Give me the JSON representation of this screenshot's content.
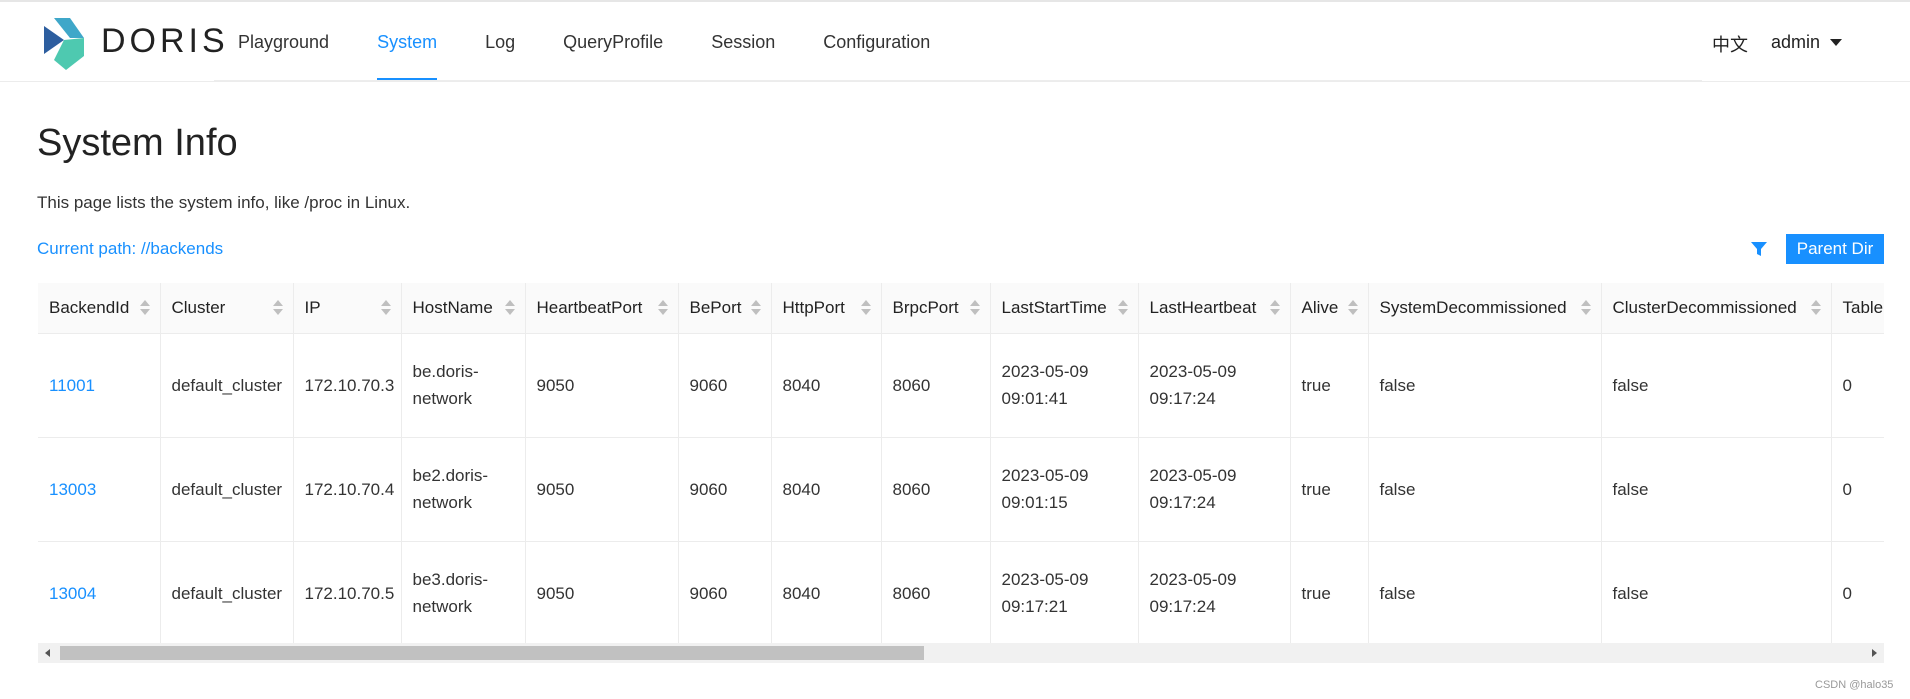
{
  "header": {
    "brand": "DORIS",
    "nav": [
      {
        "label": "Playground",
        "active": false
      },
      {
        "label": "System",
        "active": true
      },
      {
        "label": "Log",
        "active": false
      },
      {
        "label": "QueryProfile",
        "active": false
      },
      {
        "label": "Session",
        "active": false
      },
      {
        "label": "Configuration",
        "active": false
      }
    ],
    "language": "中文",
    "user": "admin"
  },
  "page": {
    "title": "System Info",
    "description": "This page lists the system info, like /proc in Linux.",
    "current_path": "Current path: //backends",
    "parent_dir_label": "Parent Dir"
  },
  "table": {
    "columns": [
      "BackendId",
      "Cluster",
      "IP",
      "HostName",
      "HeartbeatPort",
      "BePort",
      "HttpPort",
      "BrpcPort",
      "LastStartTime",
      "LastHeartbeat",
      "Alive",
      "SystemDecommissioned",
      "ClusterDecommissioned",
      "Table"
    ],
    "rows": [
      {
        "backend_id": "11001",
        "cluster": "default_cluster",
        "ip": "172.10.70.3",
        "hostname_1": "be.doris-",
        "hostname_2": "network",
        "heartbeat_port": "9050",
        "be_port": "9060",
        "http_port": "8040",
        "brpc_port": "8060",
        "last_start_1": "2023-05-09",
        "last_start_2": "09:01:41",
        "last_hb_1": "2023-05-09",
        "last_hb_2": "09:17:24",
        "alive": "true",
        "sys_decom": "false",
        "cluster_decom": "false",
        "table_num": "0"
      },
      {
        "backend_id": "13003",
        "cluster": "default_cluster",
        "ip": "172.10.70.4",
        "hostname_1": "be2.doris-",
        "hostname_2": "network",
        "heartbeat_port": "9050",
        "be_port": "9060",
        "http_port": "8040",
        "brpc_port": "8060",
        "last_start_1": "2023-05-09",
        "last_start_2": "09:01:15",
        "last_hb_1": "2023-05-09",
        "last_hb_2": "09:17:24",
        "alive": "true",
        "sys_decom": "false",
        "cluster_decom": "false",
        "table_num": "0"
      },
      {
        "backend_id": "13004",
        "cluster": "default_cluster",
        "ip": "172.10.70.5",
        "hostname_1": "be3.doris-",
        "hostname_2": "network",
        "heartbeat_port": "9050",
        "be_port": "9060",
        "http_port": "8040",
        "brpc_port": "8060",
        "last_start_1": "2023-05-09",
        "last_start_2": "09:17:21",
        "last_hb_1": "2023-05-09",
        "last_hb_2": "09:17:24",
        "alive": "true",
        "sys_decom": "false",
        "cluster_decom": "false",
        "table_num": "0"
      }
    ]
  },
  "scrollbar": {
    "thumb_fraction": 0.47
  },
  "watermark": "CSDN @halo35",
  "colors": {
    "accent": "#1890ff",
    "logo_dark": "#2d5e9f",
    "logo_light": "#4ec9b0"
  }
}
